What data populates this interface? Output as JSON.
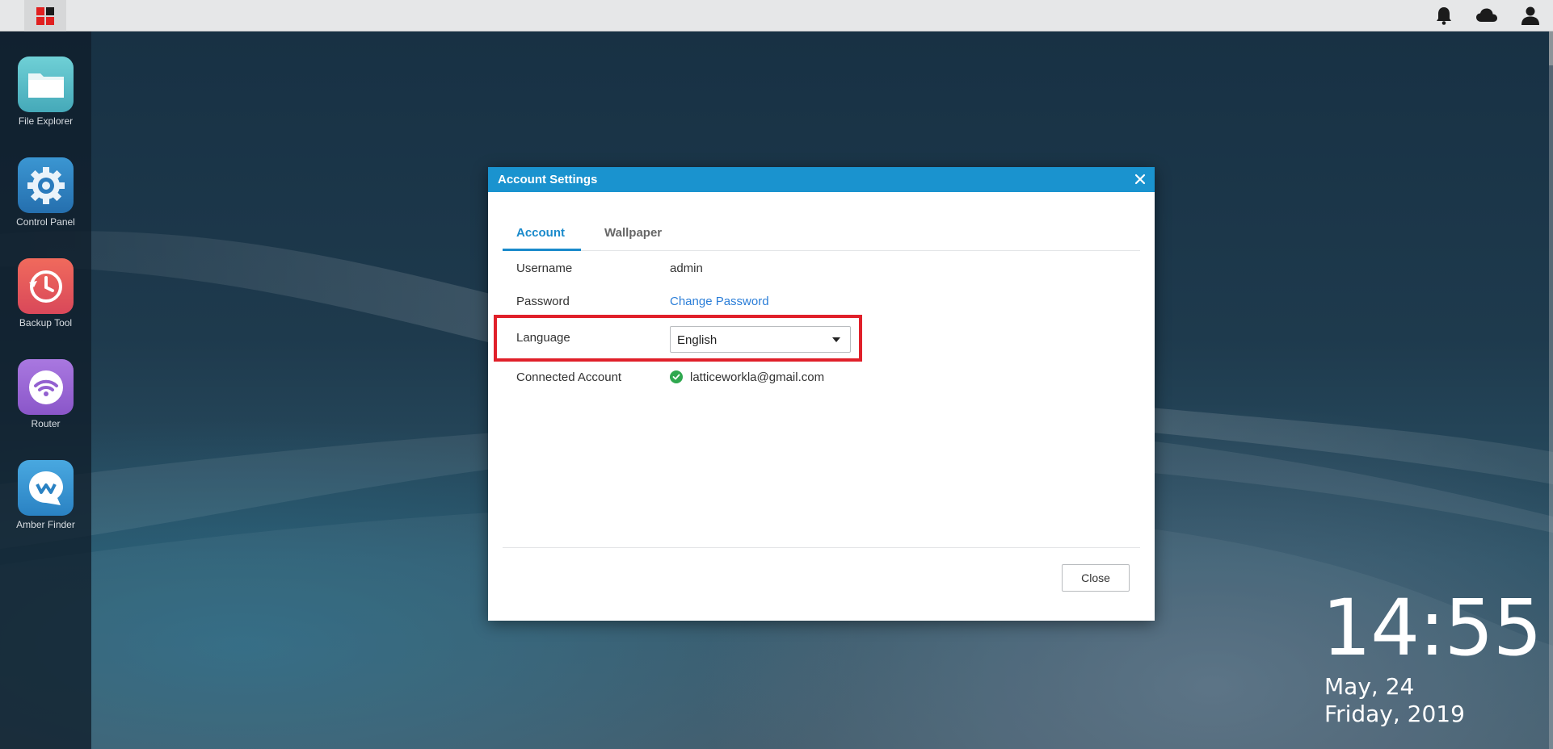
{
  "topbar": {
    "start_icon": "grid-logo-icon",
    "icons": [
      "bell-icon",
      "cloud-icon",
      "user-icon"
    ]
  },
  "sidebar": {
    "apps": [
      {
        "label": "File Explorer",
        "icon": "folder-icon",
        "color": "#5bc0c9"
      },
      {
        "label": "Control Panel",
        "icon": "gear-icon",
        "color": "#2f86c4"
      },
      {
        "label": "Backup Tool",
        "icon": "clock-backup-icon",
        "color": "#e05a5a"
      },
      {
        "label": "Router",
        "icon": "wifi-icon",
        "color": "#9b6ad6"
      },
      {
        "label": "Amber Finder",
        "icon": "chat-bubble-icon",
        "color": "#3b9ad8"
      }
    ]
  },
  "dialog": {
    "title": "Account Settings",
    "tabs": [
      {
        "label": "Account",
        "active": true
      },
      {
        "label": "Wallpaper",
        "active": false
      }
    ],
    "rows": {
      "username_label": "Username",
      "username_value": "admin",
      "password_label": "Password",
      "password_link": "Change Password",
      "language_label": "Language",
      "language_value": "English",
      "connected_label": "Connected Account",
      "connected_value": "latticeworkla@gmail.com"
    },
    "close_label": "Close"
  },
  "clock": {
    "time": "14:55",
    "date": "May, 24",
    "day_year": "Friday, 2019"
  },
  "colors": {
    "accent": "#1a93cf",
    "highlight": "#e0202a",
    "success": "#2fa84f"
  }
}
